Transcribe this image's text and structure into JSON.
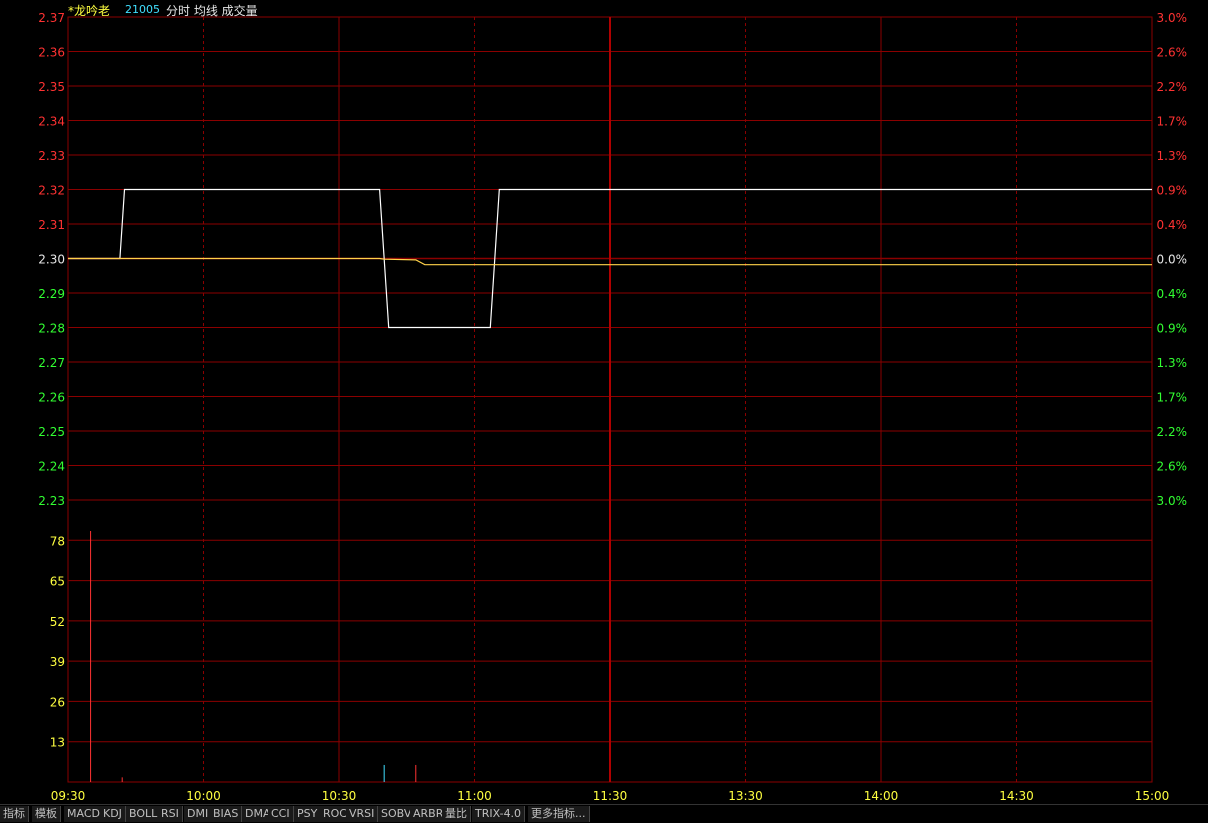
{
  "header": {
    "stock_name": "*龙吟老",
    "stock_code": "21005",
    "legend_text": "分时 均线 成交量"
  },
  "tabs": [
    "指标",
    "模板",
    "MACD",
    "KDJ",
    "BOLL",
    "RSI",
    "DMI",
    "BIAS",
    "DMA",
    "CCI",
    "PSY",
    "ROC",
    "VRSI",
    "SOBV",
    "ARBR",
    "量比",
    "TRIX-4.0",
    "更多指标..."
  ],
  "colors": {
    "up": "#ff3232",
    "down": "#32ff32",
    "flat": "#e6e6e6",
    "grid": "#8b0000",
    "price_line": "#ffffff",
    "avg_line": "#ffd24a",
    "time_label": "#ffff40",
    "volume_label": "#ffff40"
  },
  "chart_data": {
    "type": "line",
    "prev_close": 2.3,
    "price_axis": {
      "ticks": [
        2.37,
        2.36,
        2.35,
        2.34,
        2.33,
        2.32,
        2.31,
        2.3,
        2.29,
        2.28,
        2.27,
        2.26,
        2.25,
        2.24,
        2.23
      ],
      "labels": [
        "2.37",
        "2.36",
        "2.35",
        "2.34",
        "2.33",
        "2.32",
        "2.31",
        "2.30",
        "2.29",
        "2.28",
        "2.27",
        "2.26",
        "2.25",
        "2.24",
        "2.23"
      ],
      "ylim": [
        2.23,
        2.37
      ]
    },
    "pct_axis": {
      "labels": [
        "3.0%",
        "2.6%",
        "2.2%",
        "1.7%",
        "1.3%",
        "0.9%",
        "0.4%",
        "0.0%",
        "0.4%",
        "0.9%",
        "1.3%",
        "1.7%",
        "2.2%",
        "2.6%",
        "3.0%"
      ]
    },
    "volume_axis": {
      "ticks": [
        78,
        65,
        52,
        39,
        26,
        13
      ],
      "labels": [
        "78",
        "65",
        "52",
        "39",
        "26",
        "13"
      ],
      "ylim": [
        0,
        91
      ]
    },
    "x_axis": {
      "labels": [
        "09:30",
        "10:00",
        "10:30",
        "11:00",
        "11:30",
        "13:30",
        "14:00",
        "14:30",
        "15:00"
      ],
      "total_minutes": 240
    },
    "series": [
      {
        "key": "price",
        "points": [
          [
            0,
            2.3
          ],
          [
            11.5,
            2.3
          ],
          [
            12.5,
            2.32
          ],
          [
            69,
            2.32
          ],
          [
            71,
            2.28
          ],
          [
            93.5,
            2.28
          ],
          [
            95.5,
            2.32
          ],
          [
            240,
            2.32
          ]
        ]
      },
      {
        "key": "avg",
        "points": [
          [
            0,
            2.3
          ],
          [
            69,
            2.3
          ],
          [
            70,
            2.2998
          ],
          [
            77,
            2.2996
          ],
          [
            79,
            2.2982
          ],
          [
            240,
            2.2982
          ]
        ]
      }
    ],
    "volume": [
      {
        "minute": 5,
        "value": 81,
        "dir": "up"
      },
      {
        "minute": 12,
        "value": 1.5,
        "dir": "up"
      },
      {
        "minute": 70,
        "value": 5.5,
        "dir": "down"
      },
      {
        "minute": 77,
        "value": 5.5,
        "dir": "up"
      }
    ]
  }
}
